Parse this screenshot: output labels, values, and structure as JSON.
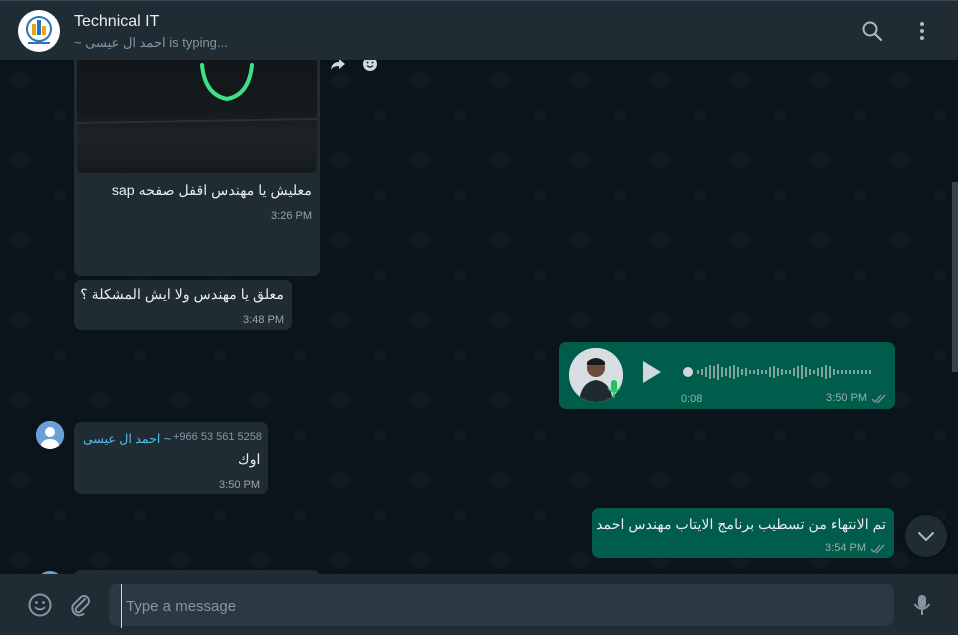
{
  "header": {
    "title": "Technical IT",
    "subtitle": "~ احمد ال عيسى is typing..."
  },
  "messages": {
    "m1": {
      "text": "معليش يا مهندس اقفل صفحه sap",
      "time": "3:26 PM"
    },
    "m2": {
      "text": "معلق يا مهندس ولا ايش المشكلة ؟",
      "time": "3:48 PM"
    },
    "voice": {
      "duration": "0:08",
      "time": "3:50 PM"
    },
    "m3": {
      "sender": "~ احمد ال عيسى",
      "phone": "+966 53 561 5258",
      "text": "اوك",
      "time": "3:50 PM"
    },
    "m4": {
      "text": "تم الانتهاء من تسطيب برنامج الايتاب مهندس احمد",
      "time": "3:54 PM"
    }
  },
  "composer": {
    "placeholder": "Type a message"
  },
  "colors": {
    "header_bg": "#202c33",
    "chat_bg": "#0b141a",
    "incoming_bubble": "#202c33",
    "outgoing_bubble": "#005c4b",
    "sender_name": "#53bdeb",
    "read_tick": "#8696a0"
  },
  "icons": {
    "search": "search-icon",
    "menu": "menu-icon",
    "emoji": "emoji-icon",
    "attach": "attach-icon",
    "mic": "mic-icon",
    "play": "play-icon",
    "forward": "forward-icon",
    "chevron": "chevron-down-icon"
  }
}
